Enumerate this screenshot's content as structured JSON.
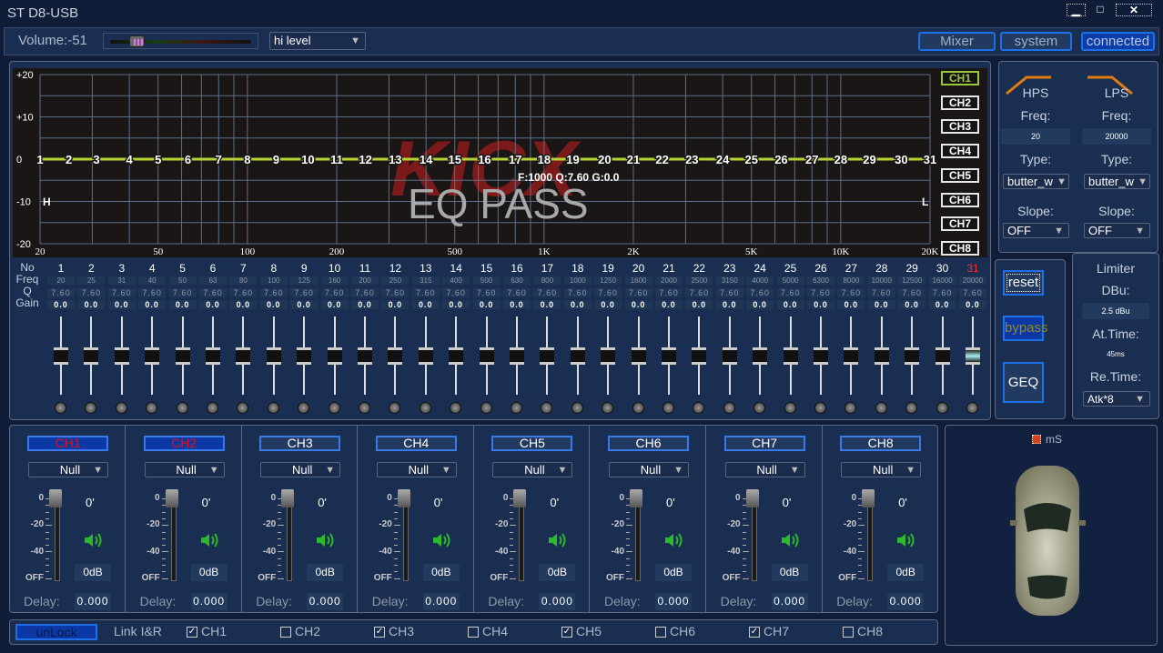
{
  "window": {
    "title": "ST D8-USB",
    "minimize": "▁",
    "maximize": "□",
    "close": "✕"
  },
  "toolbar": {
    "volume_label": "Volume:-51",
    "volume_value": -51,
    "volume_fraction": 0.15,
    "level_select": "hi level",
    "mixer": "Mixer",
    "system": "system",
    "connected": "connected"
  },
  "graph": {
    "y_ticks": [
      "+20",
      "+10",
      "0",
      "-10",
      "-20"
    ],
    "x_ticks": [
      {
        "f": 20,
        "label": "20"
      },
      {
        "f": 50,
        "label": "50"
      },
      {
        "f": 100,
        "label": "100"
      },
      {
        "f": 200,
        "label": "200"
      },
      {
        "f": 500,
        "label": "500"
      },
      {
        "f": 1000,
        "label": "1K"
      },
      {
        "f": 2000,
        "label": "2K"
      },
      {
        "f": 5000,
        "label": "5K"
      },
      {
        "f": 10000,
        "label": "10K"
      },
      {
        "f": 20000,
        "label": "20K"
      }
    ],
    "watermark": "KICX",
    "title": "EQ PASS",
    "readout": "F:1000 Q:7.60 G:0.0",
    "hp_marker": "H",
    "lp_marker": "L",
    "channels": [
      "CH1",
      "CH2",
      "CH3",
      "CH4",
      "CH5",
      "CH6",
      "CH7",
      "CH8"
    ],
    "active_channel": 0,
    "curve_color": "#b5d334"
  },
  "bands": {
    "row_labels": [
      "No",
      "Freq",
      "Q",
      "Gain"
    ],
    "items": [
      {
        "no": "1",
        "freq": "20",
        "q": "7.60",
        "gain": "0.0"
      },
      {
        "no": "2",
        "freq": "25",
        "q": "7.60",
        "gain": "0.0"
      },
      {
        "no": "3",
        "freq": "31",
        "q": "7.60",
        "gain": "0.0"
      },
      {
        "no": "4",
        "freq": "40",
        "q": "7.60",
        "gain": "0.0"
      },
      {
        "no": "5",
        "freq": "50",
        "q": "7.60",
        "gain": "0.0"
      },
      {
        "no": "6",
        "freq": "63",
        "q": "7.60",
        "gain": "0.0"
      },
      {
        "no": "7",
        "freq": "80",
        "q": "7.60",
        "gain": "0.0"
      },
      {
        "no": "8",
        "freq": "100",
        "q": "7.60",
        "gain": "0.0"
      },
      {
        "no": "9",
        "freq": "125",
        "q": "7.60",
        "gain": "0.0"
      },
      {
        "no": "10",
        "freq": "160",
        "q": "7.60",
        "gain": "0.0"
      },
      {
        "no": "11",
        "freq": "200",
        "q": "7.60",
        "gain": "0.0"
      },
      {
        "no": "12",
        "freq": "250",
        "q": "7.60",
        "gain": "0.0"
      },
      {
        "no": "13",
        "freq": "315",
        "q": "7.60",
        "gain": "0.0"
      },
      {
        "no": "14",
        "freq": "400",
        "q": "7.60",
        "gain": "0.0"
      },
      {
        "no": "15",
        "freq": "500",
        "q": "7.60",
        "gain": "0.0"
      },
      {
        "no": "16",
        "freq": "630",
        "q": "7.60",
        "gain": "0.0"
      },
      {
        "no": "17",
        "freq": "800",
        "q": "7.60",
        "gain": "0.0"
      },
      {
        "no": "18",
        "freq": "1000",
        "q": "7.60",
        "gain": "0.0"
      },
      {
        "no": "19",
        "freq": "1250",
        "q": "7.60",
        "gain": "0.0"
      },
      {
        "no": "20",
        "freq": "1600",
        "q": "7.60",
        "gain": "0.0"
      },
      {
        "no": "21",
        "freq": "2000",
        "q": "7.60",
        "gain": "0.0"
      },
      {
        "no": "22",
        "freq": "2500",
        "q": "7.60",
        "gain": "0.0"
      },
      {
        "no": "23",
        "freq": "3150",
        "q": "7.60",
        "gain": "0.0"
      },
      {
        "no": "24",
        "freq": "4000",
        "q": "7.60",
        "gain": "0.0"
      },
      {
        "no": "25",
        "freq": "5000",
        "q": "7.60",
        "gain": "0.0"
      },
      {
        "no": "26",
        "freq": "6300",
        "q": "7.60",
        "gain": "0.0"
      },
      {
        "no": "27",
        "freq": "8000",
        "q": "7.60",
        "gain": "0.0"
      },
      {
        "no": "28",
        "freq": "10000",
        "q": "7.60",
        "gain": "0.0"
      },
      {
        "no": "29",
        "freq": "12500",
        "q": "7.60",
        "gain": "0.0"
      },
      {
        "no": "30",
        "freq": "16000",
        "q": "7.60",
        "gain": "0.0"
      },
      {
        "no": "31",
        "freq": "20000",
        "q": "7.60",
        "gain": "0.0"
      }
    ],
    "selected_band": 31
  },
  "eq_buttons": {
    "reset": "reset",
    "bypass": "bypass",
    "geq": "GEQ"
  },
  "filters": {
    "hps": {
      "title": "HPS",
      "freq_label": "Freq:",
      "freq": "20",
      "type_label": "Type:",
      "type": "butter_w",
      "slope_label": "Slope:",
      "slope": "OFF"
    },
    "lps": {
      "title": "LPS",
      "freq_label": "Freq:",
      "freq": "20000",
      "type_label": "Type:",
      "type": "butter_w",
      "slope_label": "Slope:",
      "slope": "OFF"
    },
    "accent": "#e07b10"
  },
  "limiter": {
    "title": "Limiter",
    "dbu_label": "DBu:",
    "dbu": "2.5 dBu",
    "attack_label": "At.Time:",
    "attack": "45ms",
    "release_label": "Re.Time:",
    "release": "Atk*8"
  },
  "strips": {
    "scale": [
      "0",
      "-20",
      "-40",
      "OFF"
    ],
    "delay_label": "Delay:",
    "items": [
      {
        "name": "CH1",
        "source": "Null",
        "phase": "0'",
        "level": "0dB",
        "delay": "0.000",
        "selected": true
      },
      {
        "name": "CH2",
        "source": "Null",
        "phase": "0'",
        "level": "0dB",
        "delay": "0.000",
        "selected": true
      },
      {
        "name": "CH3",
        "source": "Null",
        "phase": "0'",
        "level": "0dB",
        "delay": "0.000",
        "selected": false
      },
      {
        "name": "CH4",
        "source": "Null",
        "phase": "0'",
        "level": "0dB",
        "delay": "0.000",
        "selected": false
      },
      {
        "name": "CH5",
        "source": "Null",
        "phase": "0'",
        "level": "0dB",
        "delay": "0.000",
        "selected": false
      },
      {
        "name": "CH6",
        "source": "Null",
        "phase": "0'",
        "level": "0dB",
        "delay": "0.000",
        "selected": false
      },
      {
        "name": "CH7",
        "source": "Null",
        "phase": "0'",
        "level": "0dB",
        "delay": "0.000",
        "selected": false
      },
      {
        "name": "CH8",
        "source": "Null",
        "phase": "0'",
        "level": "0dB",
        "delay": "0.000",
        "selected": false
      }
    ]
  },
  "link": {
    "unlock": "unLock",
    "label": "Link I&R",
    "channels": [
      {
        "name": "CH1",
        "checked": true
      },
      {
        "name": "CH2",
        "checked": false
      },
      {
        "name": "CH3",
        "checked": true
      },
      {
        "name": "CH4",
        "checked": false
      },
      {
        "name": "CH5",
        "checked": true
      },
      {
        "name": "CH6",
        "checked": false
      },
      {
        "name": "CH7",
        "checked": true
      },
      {
        "name": "CH8",
        "checked": false
      }
    ]
  },
  "car": {
    "ms_label": "mS"
  }
}
